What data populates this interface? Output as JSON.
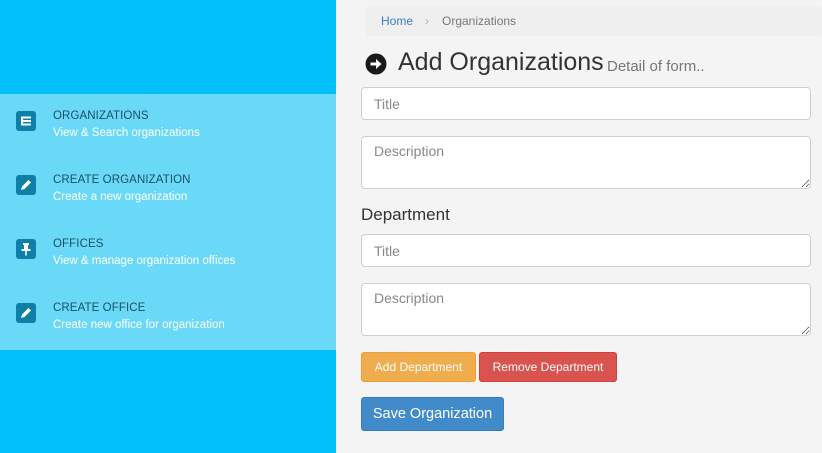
{
  "sidebar": {
    "items": [
      {
        "title": "ORGANIZATIONS",
        "subtitle": "View & Search organizations",
        "icon": "list-icon"
      },
      {
        "title": "CREATE ORGANIZATION",
        "subtitle": "Create a new organization",
        "icon": "pencil-icon"
      },
      {
        "title": "OFFICES",
        "subtitle": "View & manage organization offices",
        "icon": "pin-icon"
      },
      {
        "title": "CREATE OFFICE",
        "subtitle": "Create new office for organization",
        "icon": "pencil-icon"
      }
    ]
  },
  "breadcrumb": {
    "home": "Home",
    "separator": "›",
    "current": "Organizations"
  },
  "header": {
    "title": "Add Organizations",
    "subtitle": "Detail of form..",
    "icon": "arrow-circle-right-icon"
  },
  "form": {
    "org_title_placeholder": "Title",
    "org_description_placeholder": "Description",
    "department_label": "Department",
    "dept_title_placeholder": "Title",
    "dept_description_placeholder": "Description",
    "add_department_label": "Add Department",
    "remove_department_label": "Remove Department",
    "save_label": "Save Organization"
  },
  "colors": {
    "sidebar_bg": "#00bff9",
    "menu_bg": "#6ad9f8",
    "warning": "#f0ad4e",
    "danger": "#d9534f",
    "primary": "#428bca"
  }
}
